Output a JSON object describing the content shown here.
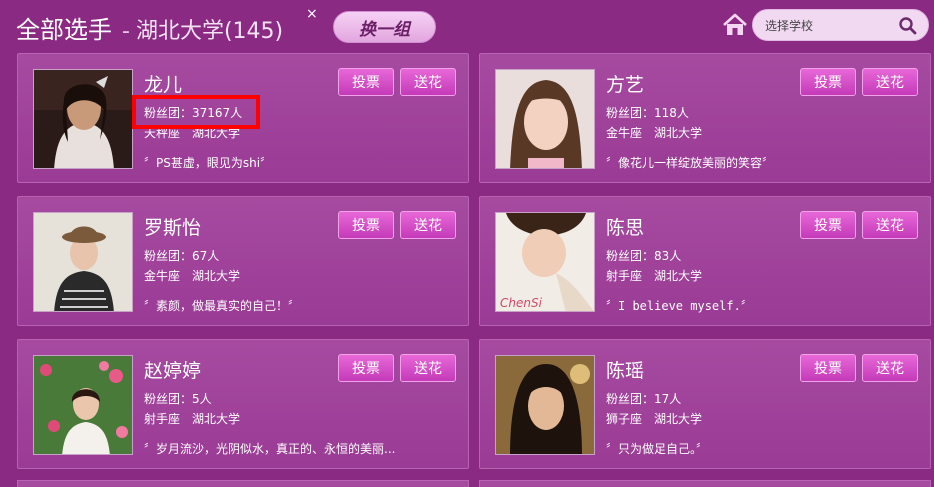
{
  "header": {
    "title": "全部选手",
    "separator": "-",
    "school": "湖北大学(145)",
    "close_label": "×",
    "swap_button": "换一组",
    "search_placeholder": "选择学校"
  },
  "contestants": [
    {
      "name": "龙儿",
      "fans": "粉丝团：37167人",
      "meta": "天秤座　湖北大学",
      "quote": "〞PS甚虚，眼见为shi〞",
      "vote": "投票",
      "flower": "送花"
    },
    {
      "name": "方艺",
      "fans": "粉丝团：118人",
      "meta": "金牛座　湖北大学",
      "quote": "〞像花儿一样绽放美丽的笑容〞",
      "vote": "投票",
      "flower": "送花"
    },
    {
      "name": "罗斯怡",
      "fans": "粉丝团：67人",
      "meta": "金牛座　湖北大学",
      "quote": "〞素颜，做最真实的自己！〞",
      "vote": "投票",
      "flower": "送花"
    },
    {
      "name": "陈思",
      "fans": "粉丝团：83人",
      "meta": "射手座　湖北大学",
      "quote": "〞I believe myself.〞",
      "vote": "投票",
      "flower": "送花",
      "photo_text": "ChenSi"
    },
    {
      "name": "赵婷婷",
      "fans": "粉丝团：5人",
      "meta": "射手座　湖北大学",
      "quote": "〞岁月流沙，光阴似水，真正的、永恒的美丽...",
      "vote": "投票",
      "flower": "送花"
    },
    {
      "name": "陈瑶",
      "fans": "粉丝团：17人",
      "meta": "狮子座　湖北大学",
      "quote": "〞只为做足自己。〞",
      "vote": "投票",
      "flower": "送花"
    }
  ]
}
